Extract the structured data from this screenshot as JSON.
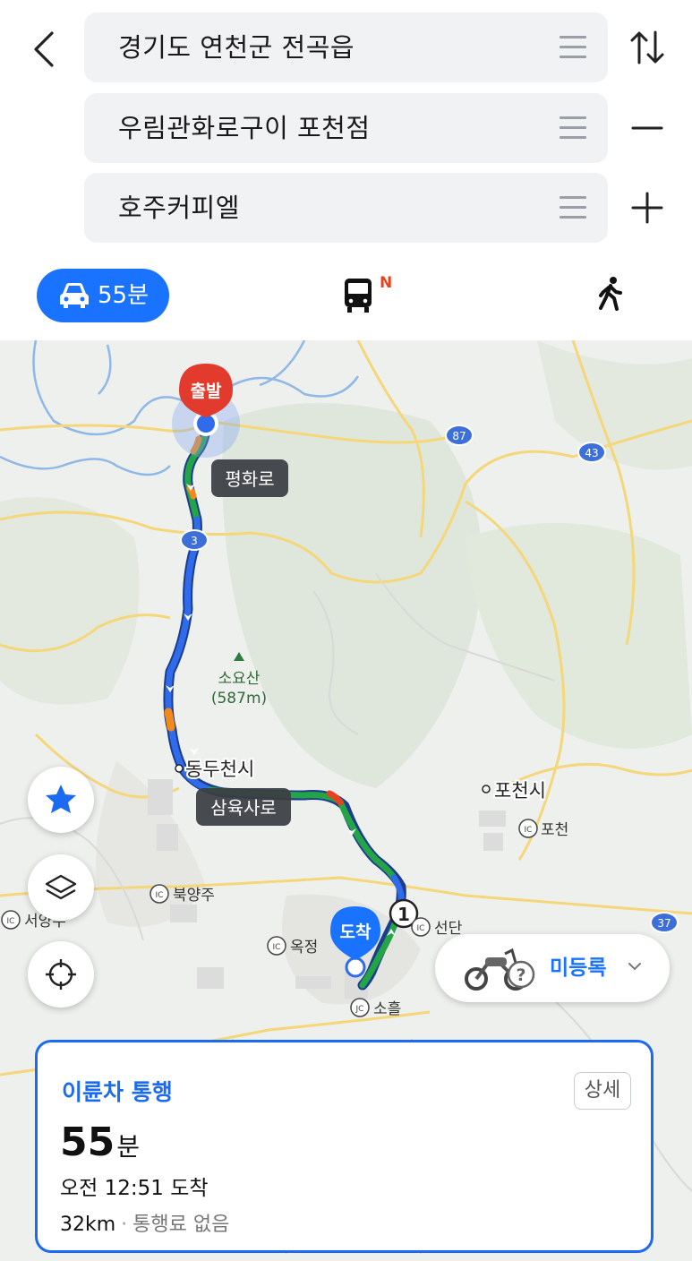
{
  "route": {
    "origin": "경기도 연천군 전곡읍",
    "waypoint": "우림관화로구이 포천점",
    "destination": "호주커피엘"
  },
  "tabs": {
    "car_time": "55분",
    "bus_badge": "N"
  },
  "map": {
    "start_label": "출발",
    "end_label": "도착",
    "road_label_1": "평화로",
    "road_label_2": "삼육사로",
    "mountain_name": "소요산",
    "mountain_height": "(587m)",
    "city_1": "동두천시",
    "city_2": "포천시",
    "ic_1": "포천",
    "ic_2": "북양주",
    "ic_3": "서양주",
    "ic_4": "옥정",
    "ic_5": "선단",
    "jc_1": "소흘",
    "route_no_1": "3",
    "route_no_2": "87",
    "route_no_3": "43",
    "route_no_4": "37",
    "waypoint_no": "1",
    "ic_tag": "IC",
    "jc_tag": "JC"
  },
  "vehicle": {
    "status": "미등록"
  },
  "summary": {
    "mode": "이륜차 통행",
    "detail_button": "상세",
    "duration_value": "55",
    "duration_unit": "분",
    "arrival": "오전 12:51 도착",
    "distance": "32km",
    "toll": "통행료 없음"
  },
  "colors": {
    "accent": "#1a73ff",
    "route_smooth": "#22a447",
    "route_slow": "#f08a1c",
    "route_jam": "#e5421f",
    "route_blue": "#2f6bea"
  }
}
